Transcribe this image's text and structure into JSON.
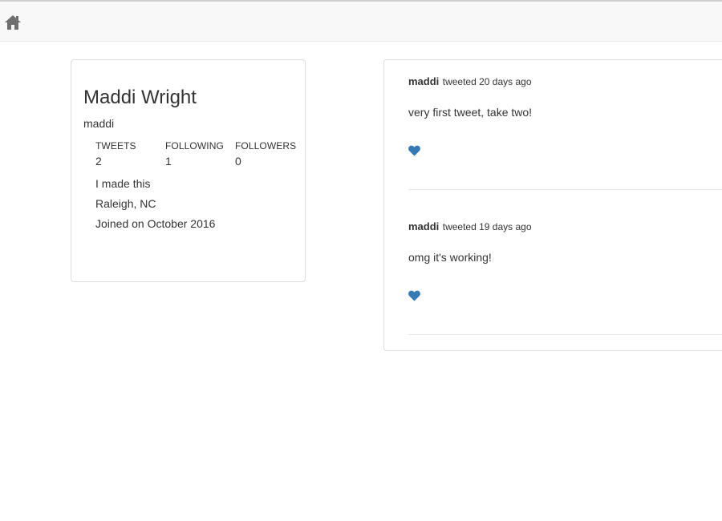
{
  "navbar": {
    "home_icon": "home-icon",
    "icon_color": "#6f6f6f"
  },
  "profile": {
    "name": "Maddi Wright",
    "username": "maddi",
    "stats": {
      "tweets_label": "TWEETS",
      "tweets_value": "2",
      "following_label": "FOLLOWING",
      "following_value": "1",
      "followers_label": "FOLLOWERS",
      "followers_value": "0"
    },
    "bio": "I made this",
    "location": "Raleigh, NC",
    "joined": "Joined on October 2016"
  },
  "tweets": [
    {
      "user": "maddi",
      "meta": "tweeted 20 days ago",
      "text": "very first tweet, take two!",
      "like_icon": "heart-icon"
    },
    {
      "user": "maddi",
      "meta": "tweeted 19 days ago",
      "text": "omg it's working!",
      "like_icon": "heart-icon"
    }
  ],
  "colors": {
    "accent": "#337ab7",
    "text": "#333333",
    "navbar_bg": "#f8f8f8",
    "border": "#dddddd"
  }
}
